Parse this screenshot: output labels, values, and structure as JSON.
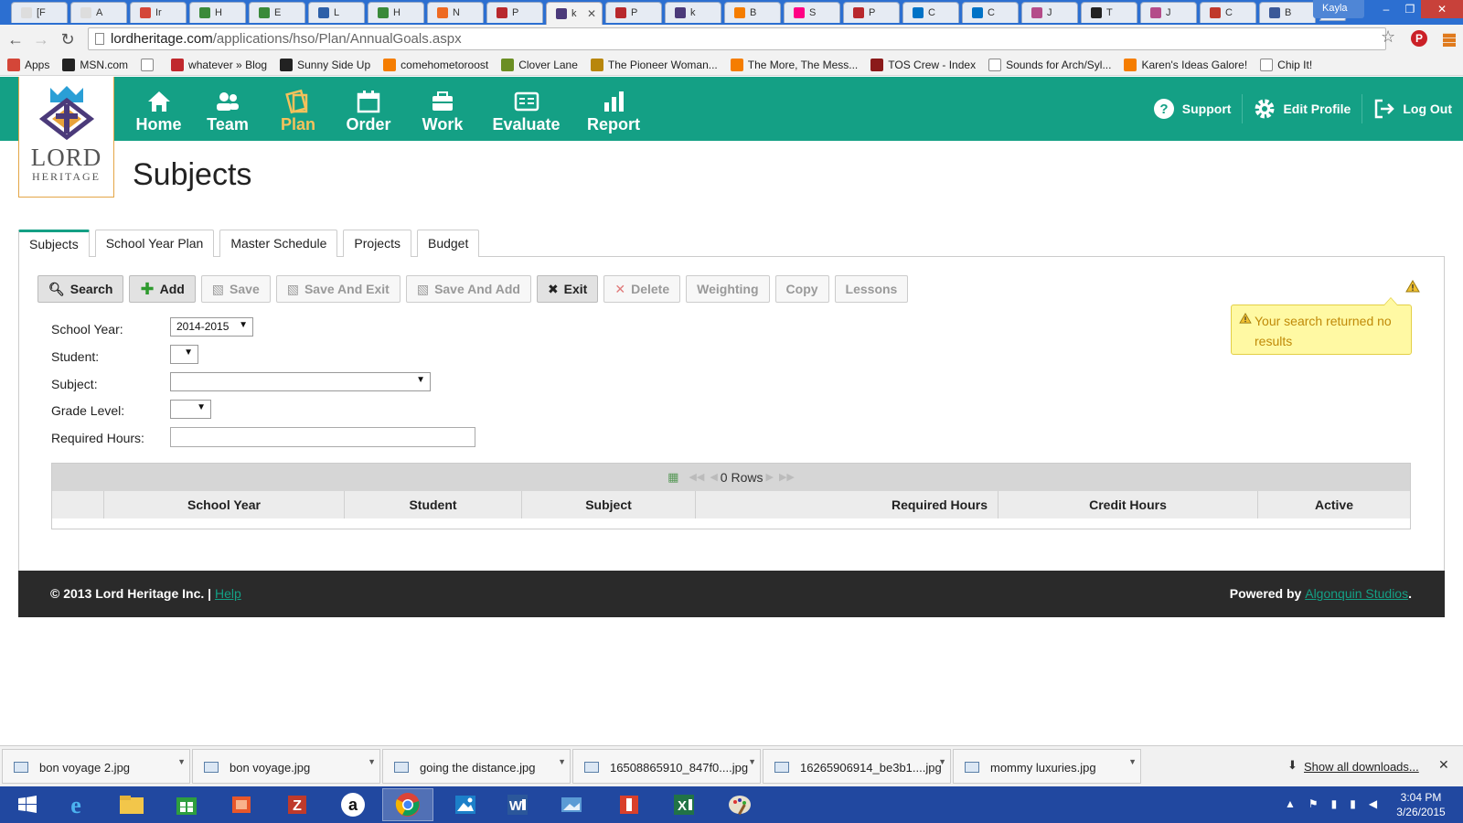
{
  "browser": {
    "tabs": [
      {
        "label": "[F",
        "icon": "doc-icon",
        "color": "#dddddd"
      },
      {
        "label": "A",
        "icon": "doc-icon",
        "color": "#dddddd"
      },
      {
        "label": "Ir",
        "icon": "gmail-icon",
        "color": "#d44638"
      },
      {
        "label": "H",
        "icon": "aplus-icon",
        "color": "#3a8a3a"
      },
      {
        "label": "E",
        "icon": "house-icon",
        "color": "#3a8a3a"
      },
      {
        "label": "L",
        "icon": "table-icon",
        "color": "#2d5fa8"
      },
      {
        "label": "H",
        "icon": "aplus-icon",
        "color": "#3a8a3a"
      },
      {
        "label": "N",
        "icon": "cloud-icon",
        "color": "#ee6a22"
      },
      {
        "label": "P",
        "icon": "q-icon",
        "color": "#b8282d"
      },
      {
        "label": "k",
        "icon": "lordheritage-icon",
        "color": "#4b3a7a",
        "active": true
      },
      {
        "label": "P",
        "icon": "q-icon",
        "color": "#b8282d"
      },
      {
        "label": "k",
        "icon": "lordheritage-icon",
        "color": "#4b3a7a"
      },
      {
        "label": "B",
        "icon": "blogger-icon",
        "color": "#f57d00"
      },
      {
        "label": "S",
        "icon": "flickr-icon",
        "color": "#ff0084"
      },
      {
        "label": "P",
        "icon": "q-icon",
        "color": "#b8282d"
      },
      {
        "label": "C",
        "icon": "outlook-icon",
        "color": "#0072c6"
      },
      {
        "label": "C",
        "icon": "outlook-icon",
        "color": "#0072c6"
      },
      {
        "label": "J",
        "icon": "flower-icon",
        "color": "#b44c8a"
      },
      {
        "label": "T",
        "icon": "g-icon",
        "color": "#222222"
      },
      {
        "label": "J",
        "icon": "flower-icon",
        "color": "#b44c8a"
      },
      {
        "label": "C",
        "icon": "table-icon",
        "color": "#c0392b"
      },
      {
        "label": "B",
        "icon": "facebook-icon",
        "color": "#3b5998"
      }
    ],
    "user": "Kayla",
    "url_host": "lordheritage.com",
    "url_path": "/applications/hso/Plan/AnnualGoals.aspx",
    "bookmarks": [
      {
        "label": "Apps",
        "icon": "apps-icon",
        "color": "#d44638"
      },
      {
        "label": "MSN.com",
        "icon": "msn-icon",
        "color": "#222222"
      },
      {
        "label": "",
        "icon": "page-icon",
        "color": "#ffffff"
      },
      {
        "label": "whatever » Blog",
        "icon": "w-icon",
        "color": "#c0282d"
      },
      {
        "label": "Sunny Side Up",
        "icon": "g-icon",
        "color": "#222222"
      },
      {
        "label": "comehometoroost",
        "icon": "blogger-icon",
        "color": "#f57d00"
      },
      {
        "label": "Clover Lane",
        "icon": "tree-icon",
        "color": "#6b8e23"
      },
      {
        "label": "The Pioneer Woman...",
        "icon": "pw-icon",
        "color": "#b8860b"
      },
      {
        "label": "The More, The Mess...",
        "icon": "blogger-icon",
        "color": "#f57d00"
      },
      {
        "label": "TOS Crew - Index",
        "icon": "tos-icon",
        "color": "#8b1a1a"
      },
      {
        "label": "Sounds for Arch/Syl...",
        "icon": "page-icon",
        "color": "#ffffff"
      },
      {
        "label": "Karen's Ideas Galore!",
        "icon": "blogger-icon",
        "color": "#f57d00"
      },
      {
        "label": "Chip It!",
        "icon": "page-icon",
        "color": "#ffffff"
      }
    ]
  },
  "site": {
    "logo": {
      "line1": "LORD",
      "line2": "HERITAGE"
    },
    "nav": [
      {
        "label": "Home",
        "icon": "home-icon",
        "width": 0
      },
      {
        "label": "Team",
        "icon": "team-icon"
      },
      {
        "label": "Plan",
        "icon": "plan-icon",
        "active": true
      },
      {
        "label": "Order",
        "icon": "order-icon"
      },
      {
        "label": "Work",
        "icon": "work-icon"
      },
      {
        "label": "Evaluate",
        "icon": "evaluate-icon"
      },
      {
        "label": "Report",
        "icon": "report-icon"
      }
    ],
    "right_nav": [
      {
        "label": "Support",
        "icon": "help-icon"
      },
      {
        "label": "Edit Profile",
        "icon": "gear-icon"
      },
      {
        "label": "Log Out",
        "icon": "logout-icon"
      }
    ],
    "accent": "#14a085",
    "active_nav_color": "#f5c15b"
  },
  "page": {
    "title": "Subjects",
    "subtabs": [
      "Subjects",
      "School Year Plan",
      "Master Schedule",
      "Projects",
      "Budget"
    ],
    "buttons": [
      {
        "label": "Search",
        "icon": "search-icon",
        "enabled": true
      },
      {
        "label": "Add",
        "icon": "plus-icon",
        "enabled": true
      },
      {
        "label": "Save",
        "icon": "save-icon",
        "enabled": false
      },
      {
        "label": "Save And Exit",
        "icon": "save-exit-icon",
        "enabled": false
      },
      {
        "label": "Save And Add",
        "icon": "save-add-icon",
        "enabled": false
      },
      {
        "label": "Exit",
        "icon": "close-icon",
        "enabled": true
      },
      {
        "label": "Delete",
        "icon": "delete-icon",
        "enabled": false
      },
      {
        "label": "Weighting",
        "enabled": false
      },
      {
        "label": "Copy",
        "enabled": false
      },
      {
        "label": "Lessons",
        "enabled": false
      }
    ],
    "form": {
      "school_year_label": "School Year:",
      "school_year_value": "2014-2015",
      "student_label": "Student:",
      "student_value": "",
      "subject_label": "Subject:",
      "subject_value": "",
      "grade_label": "Grade Level:",
      "grade_value": "",
      "hours_label": "Required Hours:",
      "hours_value": ""
    },
    "warning": "Your search returned no results",
    "grid": {
      "rows_text": "0 Rows",
      "columns": [
        "",
        "School Year",
        "Student",
        "Subject",
        "Required Hours",
        "Credit Hours",
        "Active"
      ]
    },
    "footer": {
      "copyright": "© 2013 Lord Heritage Inc.",
      "separator": "|",
      "help": "Help",
      "powered_by": "Powered by",
      "studio": "Algonquin Studios",
      "period": "."
    }
  },
  "downloads": {
    "items": [
      "bon voyage 2.jpg",
      "bon voyage.jpg",
      "going the distance.jpg",
      "16508865910_847f0....jpg",
      "16265906914_be3b1....jpg",
      "mommy luxuries.jpg"
    ],
    "show_all": "Show all downloads..."
  },
  "taskbar": {
    "apps": [
      "start-icon",
      "ie-icon",
      "explorer-icon",
      "store-icon",
      "office-icon",
      "filezilla-icon",
      "amazon-icon",
      "chrome-icon",
      "photos-icon",
      "word-icon",
      "photo-viewer-icon",
      "onenote-icon",
      "excel-icon",
      "paint-icon"
    ],
    "time": "3:04 PM",
    "date": "3/26/2015"
  }
}
